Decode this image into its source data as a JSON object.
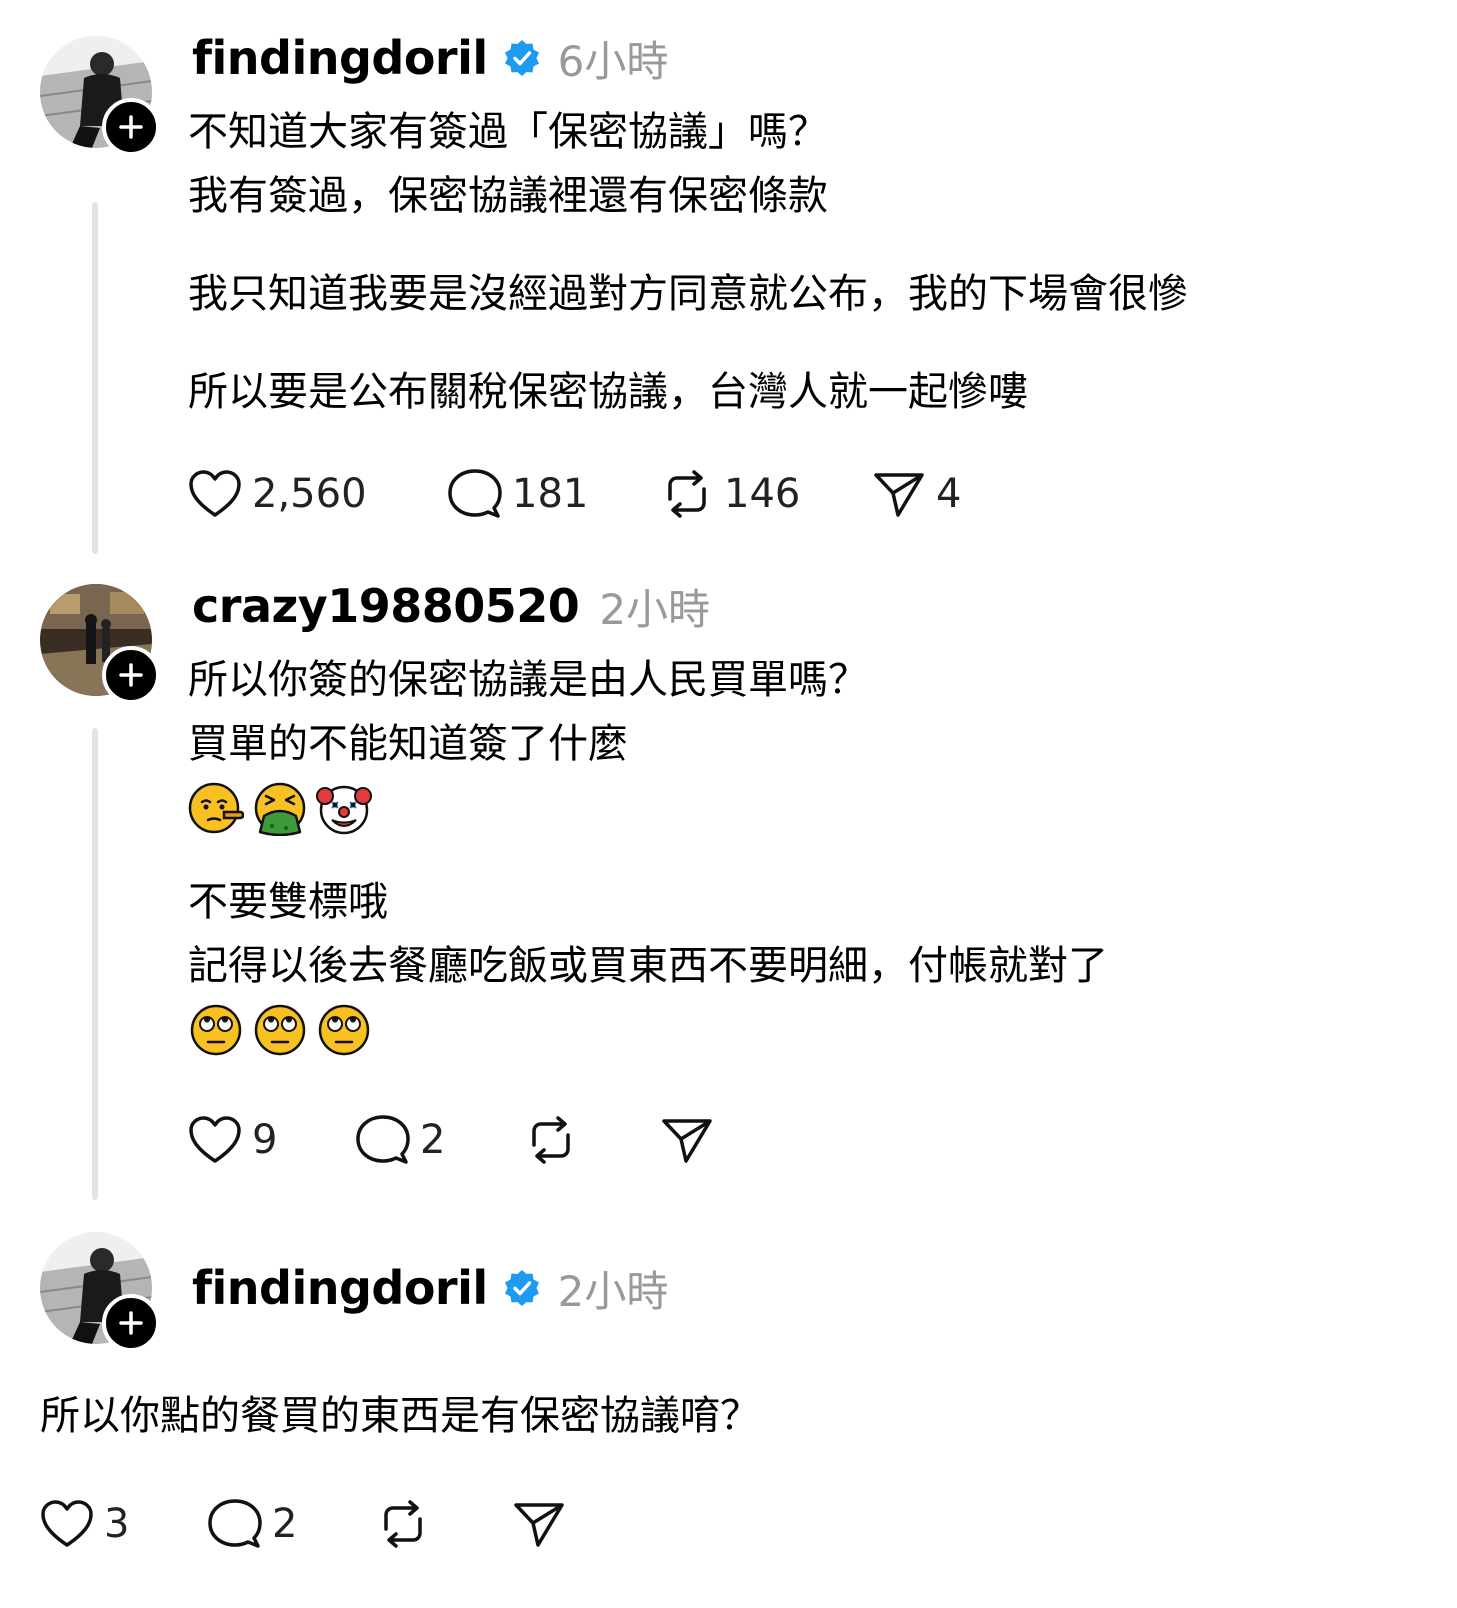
{
  "posts": [
    {
      "username": "findingdoril",
      "verified": true,
      "time": "6小時",
      "paragraphs": [
        [
          "不知道大家有簽過「保密協議」嗎？",
          "我有簽過，保密協議裡還有保密條款"
        ],
        [
          "我只知道我要是沒經過對方同意就公布，我的下場會很慘"
        ],
        [
          "所以要是公布關稅保密協議，台灣人就一起慘嘍"
        ]
      ],
      "likes": "2,560",
      "replies": "181",
      "reposts": "146",
      "shares": "4"
    },
    {
      "username": "crazy19880520",
      "verified": false,
      "time": "2小時",
      "lines1": [
        "所以你簽的保密協議是由人民買單嗎？",
        "買單的不能知道簽了什麼"
      ],
      "emojis1": [
        "lying-face",
        "vomiting-face",
        "clown-face"
      ],
      "lines2": [
        "不要雙標哦",
        "記得以後去餐廳吃飯或買東西不要明細，付帳就對了"
      ],
      "emojis2": [
        "eye-roll-face",
        "eye-roll-face",
        "eye-roll-face"
      ],
      "likes": "9",
      "replies": "2"
    },
    {
      "username": "findingdoril",
      "verified": true,
      "time": "2小時",
      "text": "所以你點的餐買的東西是有保密協議唷？",
      "likes": "3",
      "replies": "2"
    }
  ],
  "colors": {
    "verified": "#1d9bf0",
    "muted": "#999999",
    "thread": "#e3e3e3"
  }
}
